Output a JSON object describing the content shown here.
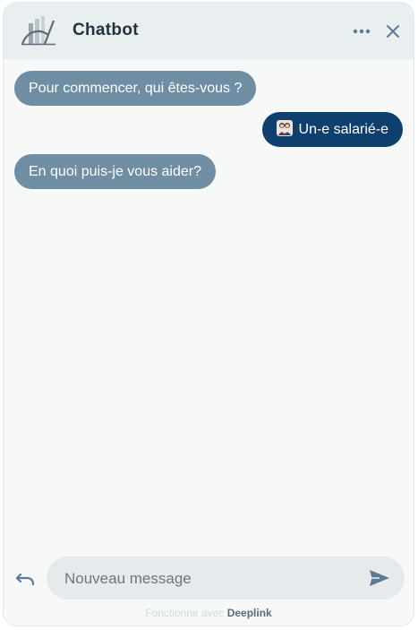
{
  "header": {
    "title": "Chatbot",
    "logo_icon": "chart-logo-icon",
    "more_icon": "more-horizontal-icon",
    "close_icon": "close-icon"
  },
  "messages": [
    {
      "role": "bot",
      "text": "Pour commencer, qui êtes-vous ?"
    },
    {
      "role": "user",
      "icon": "people-emoji-icon",
      "text": "Un-e salarié-e"
    },
    {
      "role": "bot",
      "text": "En quoi puis-je vous aider?"
    }
  ],
  "composer": {
    "placeholder": "Nouveau message",
    "value": "",
    "undo_icon": "undo-icon",
    "send_icon": "send-icon"
  },
  "footer": {
    "prefix": "Fonctionne avec",
    "brand": "Deeplink"
  },
  "colors": {
    "header_bg": "#e9eef1",
    "bot_bubble": "#6f8da3",
    "user_bubble": "#0f3f6c",
    "icon": "#5a7b94"
  }
}
